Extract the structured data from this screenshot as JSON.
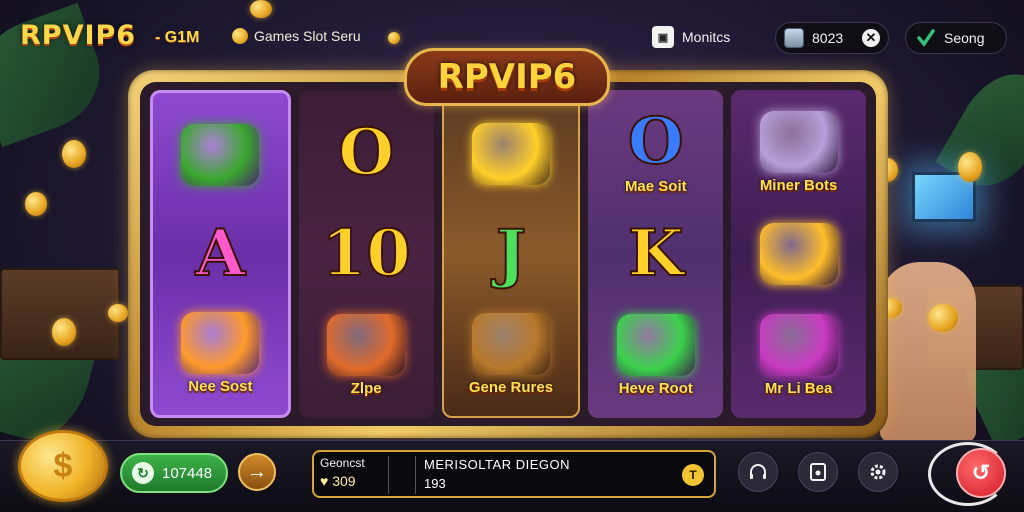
{
  "header": {
    "logo": "RPVIP6",
    "logo_sub": "- G1M",
    "games_link": "Games Slot Seru",
    "monitor_label": "Monitcs",
    "monitor_icon": "monitor-icon",
    "balance": "8023",
    "setting_label": "Seong"
  },
  "machine": {
    "title": "RPVIP6",
    "reels": [
      {
        "cells": [
          {
            "kind": "icon",
            "icon": "emerald-chest-icon",
            "color": "#3aa82e"
          },
          {
            "kind": "letter",
            "text": "A",
            "color": "#ff5acb"
          },
          {
            "kind": "icon",
            "icon": "orb-flower-icon",
            "color": "#ff9a2a",
            "caption": "Nee Sost"
          }
        ]
      },
      {
        "cells": [
          {
            "kind": "letter",
            "text": "O",
            "color": "#ffcf2a"
          },
          {
            "kind": "letter",
            "text": "10",
            "color": "#ffcf2a"
          },
          {
            "kind": "icon",
            "icon": "round-shield-icon",
            "color": "#e06a2a",
            "caption": "Zlpe"
          }
        ]
      },
      {
        "cells": [
          {
            "kind": "icon",
            "icon": "gold-coin-icon",
            "color": "#ffcf2a"
          },
          {
            "kind": "letter",
            "text": "J",
            "color": "#4ee05a"
          },
          {
            "kind": "icon",
            "icon": "treasure-chest-icon",
            "color": "#b8782a",
            "caption": "Gene Rures"
          }
        ]
      },
      {
        "cells": [
          {
            "kind": "letter",
            "text": "O",
            "color": "#3a7aff",
            "caption": "Mae Soit"
          },
          {
            "kind": "letter",
            "text": "K",
            "color": "#ffcf2a"
          },
          {
            "kind": "icon",
            "icon": "green-star-icon",
            "color": "#3ad24a",
            "caption": "Heve Root"
          }
        ]
      },
      {
        "cells": [
          {
            "kind": "icon",
            "icon": "mine-cart-icon",
            "color": "#b6a0d8",
            "caption": "Miner Bots"
          },
          {
            "kind": "icon",
            "icon": "banana-icon",
            "color": "#ffbe2a"
          },
          {
            "kind": "icon",
            "icon": "magenta-gem-icon",
            "color": "#c83ac0",
            "caption": "Mr Li Bea"
          }
        ]
      }
    ]
  },
  "footer": {
    "win_value": "107448",
    "info_left_label": "Geoncst",
    "info_left_value": "309",
    "info_right_line1": "MERISOLTAR DIEGON",
    "info_right_line2": "193",
    "info_badge": "T",
    "buttons": [
      "headset-icon",
      "card-icon",
      "gear-icon"
    ]
  }
}
